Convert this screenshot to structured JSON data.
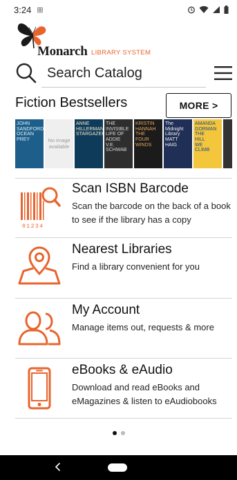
{
  "status": {
    "time": "3:24",
    "notif_glyph": "⊞"
  },
  "logo": {
    "brand": "Monarch",
    "subtitle": "LIBRARY SYSTEM",
    "icon": "butterfly-icon"
  },
  "search": {
    "label": "Search Catalog",
    "icon": "search-icon",
    "menu_icon": "hamburger-menu-icon"
  },
  "section": {
    "title": "Fiction Bestsellers",
    "more_label": "MORE >"
  },
  "books": [
    {
      "lines": [
        "JOHN",
        "SANDFORD",
        "OCEAN",
        "PREY"
      ],
      "bg": "#1d5f8a",
      "fg": "#dfeff8"
    },
    {
      "lines": [
        "No image",
        "available"
      ],
      "noimg": true
    },
    {
      "lines": [
        "ANNE",
        "HILLERMAN",
        "STARGAZER"
      ],
      "bg": "#0f3b5a",
      "fg": "#f1e6c8"
    },
    {
      "lines": [
        "THE",
        "INVISIBLE",
        "LIFE OF",
        "ADDIE",
        "V.E.",
        "SCHWAB"
      ],
      "bg": "#2e2e2e",
      "fg": "#d9d9d9"
    },
    {
      "lines": [
        "KRISTIN",
        "HANNAH",
        "THE",
        "FOUR WINDS"
      ],
      "bg": "#1b1b1b",
      "fg": "#e3a55a"
    },
    {
      "lines": [
        "The",
        "Midnight",
        "Library",
        "MATT HAIG"
      ],
      "bg": "#1f2f55",
      "fg": "#f0f0f0"
    },
    {
      "lines": [
        "AMANDA",
        "GORMAN",
        "THE",
        "HILL",
        "WE",
        "CLIMB"
      ],
      "bg": "#f3c63c",
      "fg": "#1b4a8a"
    },
    {
      "lines": [
        ""
      ],
      "bg": "#333333",
      "fg": "#ffffff",
      "slim": true
    }
  ],
  "menu": [
    {
      "title": "Scan ISBN Barcode",
      "desc": "Scan the barcode on the back of a book to see if the library has a copy",
      "icon": "barcode-scan-icon",
      "barcode_digits": "01234"
    },
    {
      "title": "Nearest Libraries",
      "desc": "Find a library convenient for you",
      "icon": "map-pin-icon"
    },
    {
      "title": "My Account",
      "desc": "Manage items out, requests & more",
      "icon": "users-icon"
    },
    {
      "title": "eBooks & eAudio",
      "desc": "Download and read eBooks and eMagazines & listen to eAudiobooks",
      "icon": "smartphone-icon"
    }
  ],
  "pager": {
    "count": 2,
    "active": 0
  },
  "colors": {
    "accent": "#e8642c",
    "text": "#111111",
    "divider": "#d4d4d4"
  }
}
